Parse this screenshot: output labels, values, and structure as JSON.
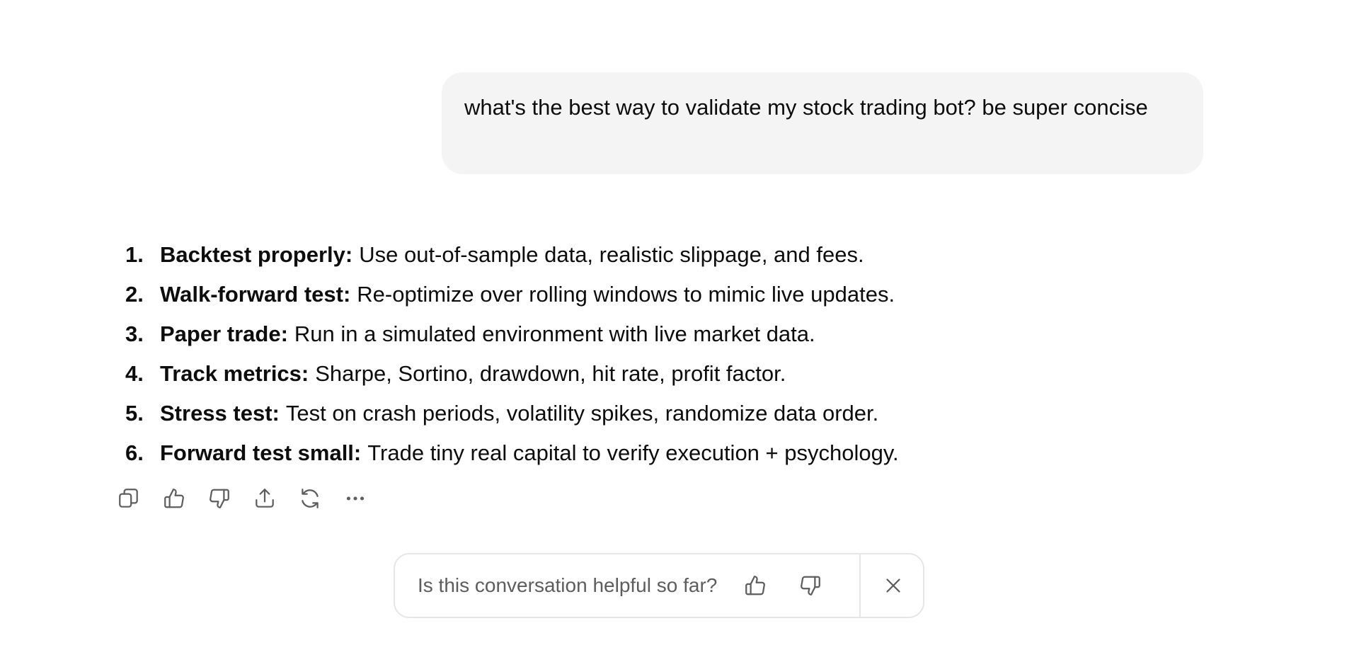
{
  "user_message": {
    "text": "what's the best way to validate my stock trading bot? be super concise"
  },
  "answer": {
    "items": [
      {
        "number": "1.",
        "title": "Backtest properly:",
        "text": "Use out-of-sample data, realistic slippage, and fees."
      },
      {
        "number": "2.",
        "title": "Walk-forward test:",
        "text": "Re-optimize over rolling windows to mimic live updates."
      },
      {
        "number": "3.",
        "title": "Paper trade:",
        "text": "Run in a simulated environment with live market data."
      },
      {
        "number": "4.",
        "title": "Track metrics:",
        "text": "Sharpe, Sortino, drawdown, hit rate, profit factor."
      },
      {
        "number": "5.",
        "title": "Stress test:",
        "text": "Test on crash periods, volatility spikes, randomize data order."
      },
      {
        "number": "6.",
        "title": "Forward test small:",
        "text": "Trade tiny real capital to verify execution + psychology."
      }
    ]
  },
  "actions": {
    "icons": [
      "copy-icon",
      "thumbs-up-icon",
      "thumbs-down-icon",
      "share-icon",
      "regenerate-icon",
      "more-icon"
    ]
  },
  "feedback": {
    "prompt": "Is this conversation helpful so far?",
    "icons": [
      "thumbs-up-icon",
      "thumbs-down-icon",
      "close-icon"
    ]
  },
  "colors": {
    "bubble_bg": "#f4f4f4",
    "text": "#0d0d0d",
    "icon": "#5d5d5d",
    "border": "#e6e6e6"
  }
}
